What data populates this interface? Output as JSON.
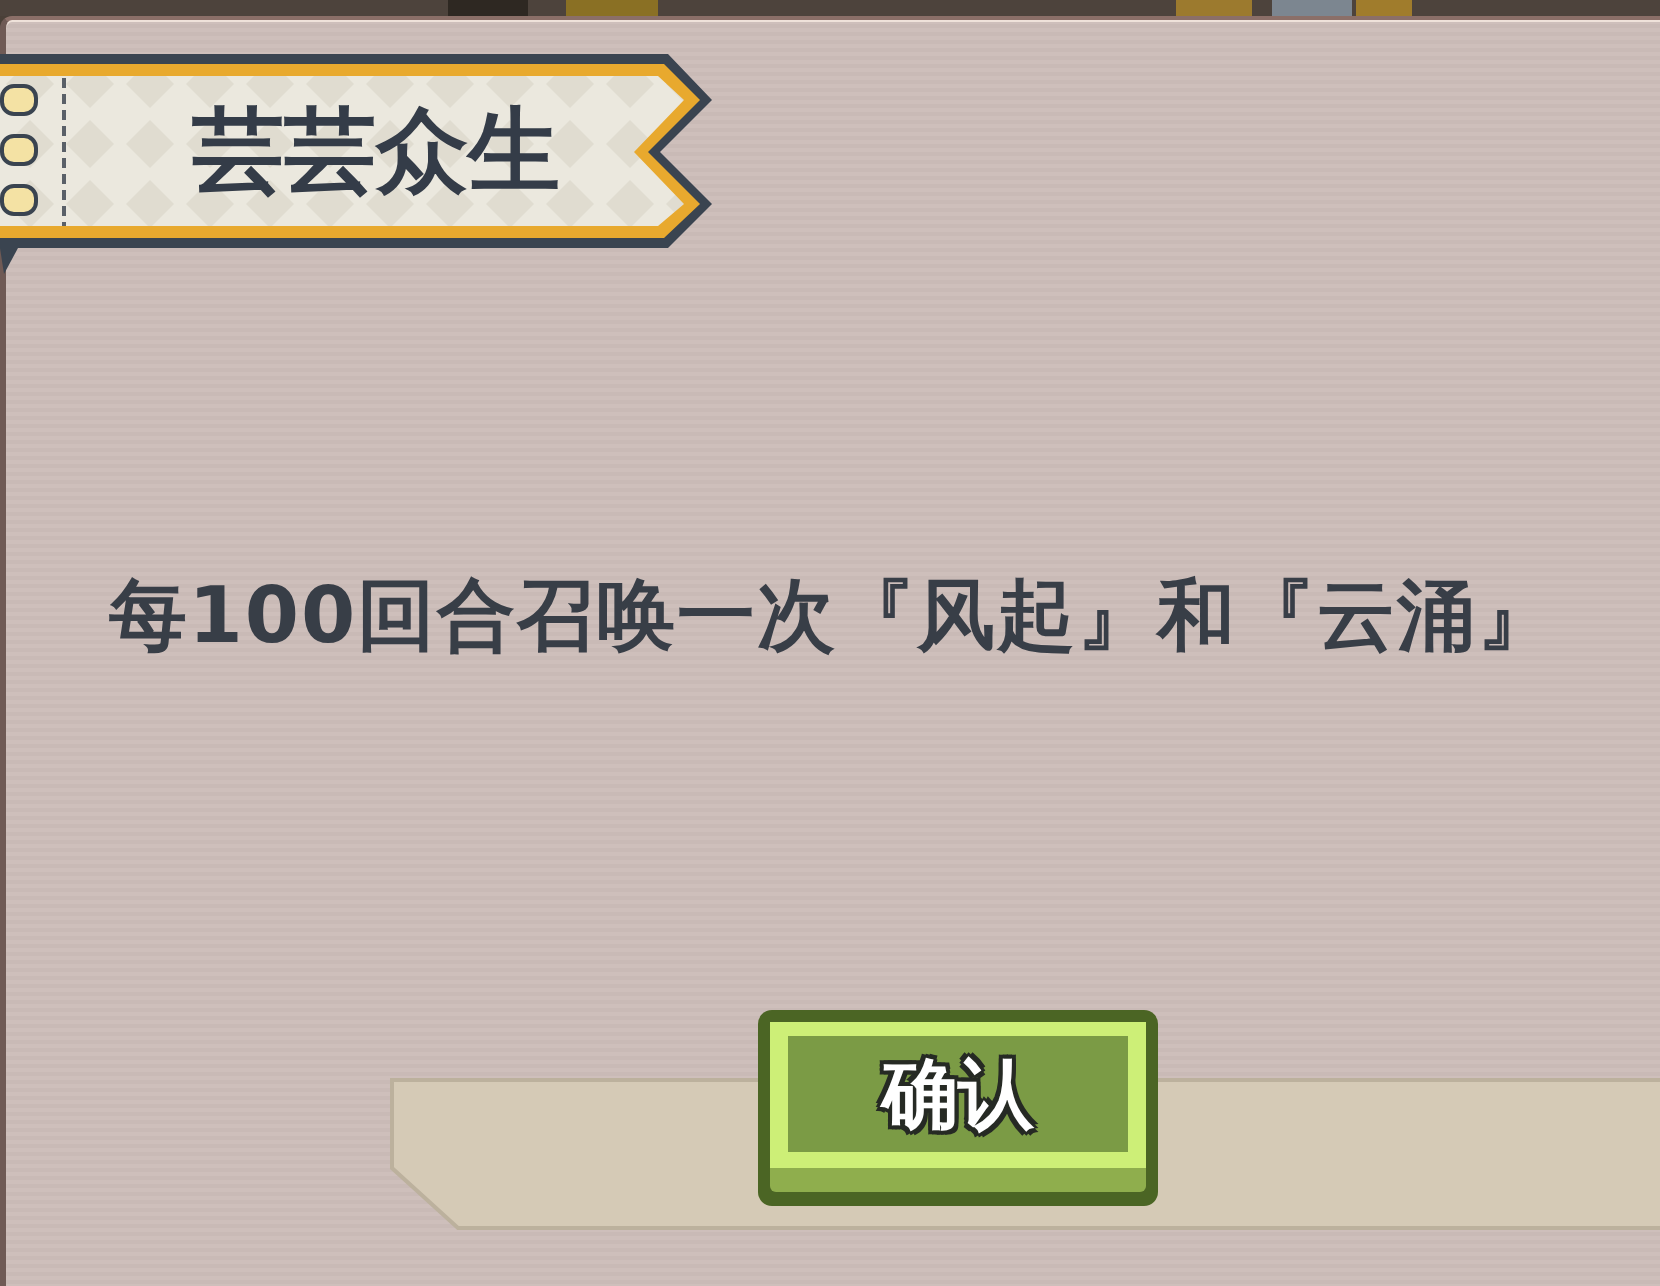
{
  "dialog": {
    "title": "芸芸众生",
    "message": "每100回合召唤一次『风起』和『云涌』",
    "buttons": [
      {
        "label": "确认",
        "kind": "confirm"
      }
    ]
  }
}
